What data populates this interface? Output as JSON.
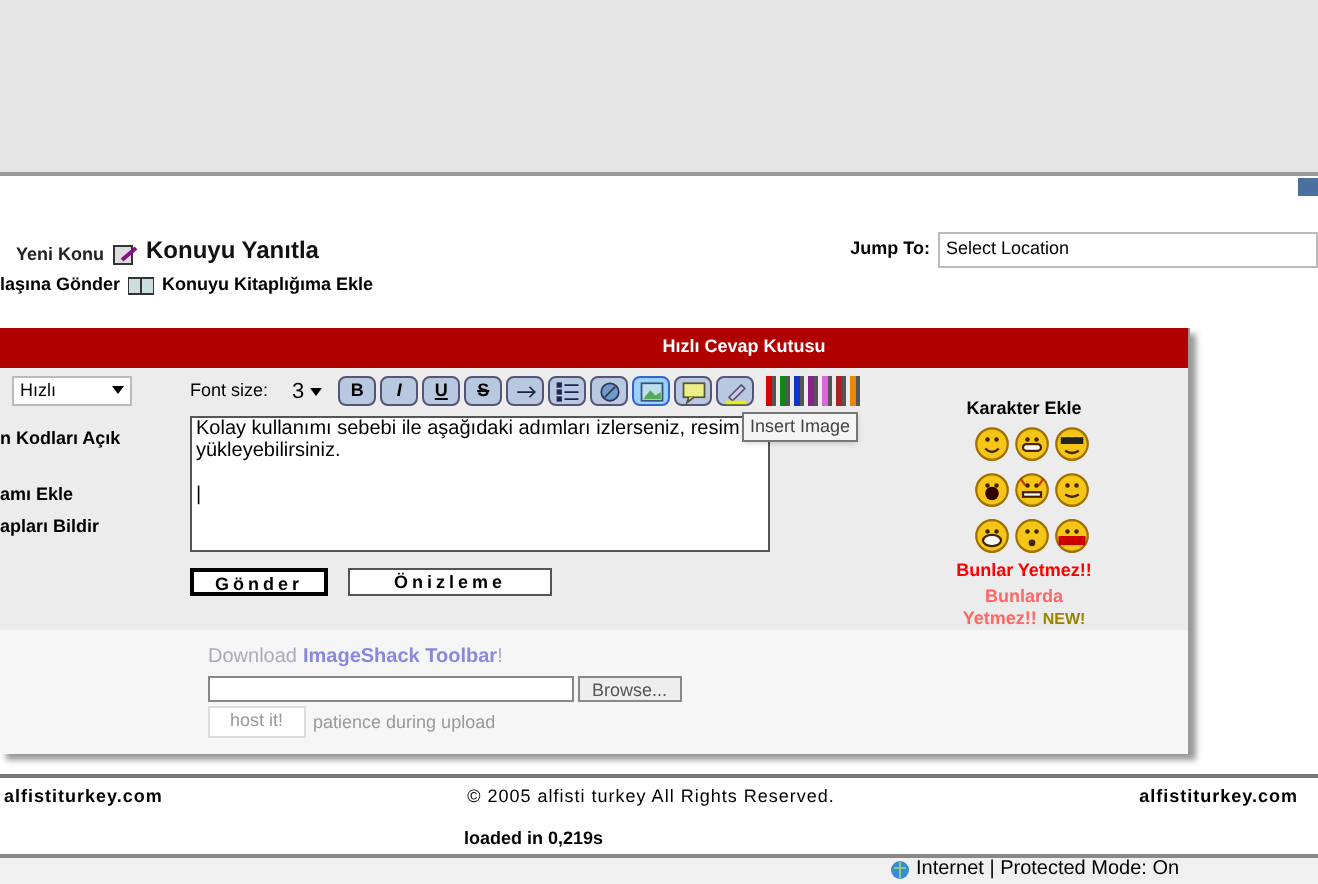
{
  "top_links": [
    {
      "label": "Yeni Konu"
    },
    {
      "label": "Konuyu Yanıtla"
    }
  ],
  "second_links": [
    {
      "label": "laşına Gönder"
    },
    {
      "label": "Konuyu Kitaplığıma Ekle"
    }
  ],
  "jump_to": {
    "label": "Jump To:",
    "value": "Select Location"
  },
  "quick_reply": {
    "title": "Hızlı Cevap Kutusu",
    "mode": "Hızlı",
    "options": [
      "n Kodları Açık",
      "amı Ekle",
      "apları Bildir"
    ],
    "font_size_label": "Font size:",
    "font_size": "3",
    "format_buttons": [
      "B",
      "I",
      "U",
      "S"
    ],
    "tool_buttons": [
      {
        "kind": "line",
        "selected": false
      },
      {
        "kind": "list",
        "selected": false
      },
      {
        "kind": "link",
        "selected": false
      },
      {
        "kind": "image",
        "selected": true
      },
      {
        "kind": "quote",
        "selected": false
      },
      {
        "kind": "highlight",
        "selected": false
      }
    ],
    "colors": [
      {
        "color": "#dd0000"
      },
      {
        "color": "#118811"
      },
      {
        "color": "#1133cc"
      },
      {
        "color": "#882288"
      },
      {
        "color": "#dd66dd"
      },
      {
        "color": "#aa2222"
      },
      {
        "color": "#ee8800"
      }
    ],
    "tooltip": "Insert Image",
    "message": "Kolay kullanımı sebebi ile aşağıdaki adımları izlerseniz, resim yükleyebilirsiniz.\n\n|",
    "buttons": [
      "Gönder",
      "Önizleme"
    ],
    "smileys_title": "Karakter Ekle",
    "smileys": [
      {
        "kind": "smile"
      },
      {
        "kind": "grin"
      },
      {
        "kind": "cool"
      },
      {
        "kind": "shout"
      },
      {
        "kind": "devil"
      },
      {
        "kind": "wink"
      },
      {
        "kind": "laugh"
      },
      {
        "kind": "surprised"
      },
      {
        "kind": "help"
      }
    ],
    "more_link": "Bunlar Yetmez!!",
    "more_link2": "Bunlarda",
    "more_link3": "Yetmez!!",
    "new_badge": "NEW!"
  },
  "upload": {
    "download_text": "Download",
    "toolbar_link": "ImageShack Toolbar",
    "exclaim": "!",
    "browse": "Browse...",
    "host_button": "host it!",
    "note": "patience during upload"
  },
  "footer": {
    "left": "alfistiturkey.com",
    "center": "© 2005 alfisti turkey All Rights Reserved.",
    "right": "alfistiturkey.com",
    "loaded": "loaded in 0,219s"
  },
  "status_bar": {
    "zone": "Internet | Protected Mode: On"
  }
}
